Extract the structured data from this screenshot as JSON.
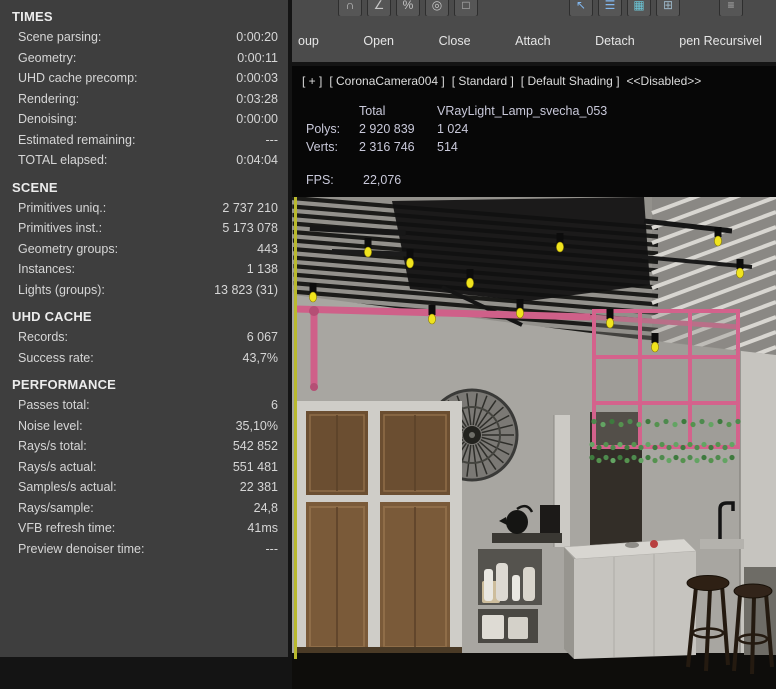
{
  "panel": {
    "sections": [
      {
        "title": "TIMES",
        "rows": [
          {
            "label": "Scene parsing:",
            "value": "0:00:20"
          },
          {
            "label": "Geometry:",
            "value": "0:00:11"
          },
          {
            "label": "UHD cache precomp:",
            "value": "0:00:03"
          },
          {
            "label": "Rendering:",
            "value": "0:03:28"
          },
          {
            "label": "Denoising:",
            "value": "0:00:00"
          },
          {
            "label": "Estimated remaining:",
            "value": "---"
          },
          {
            "label": "TOTAL elapsed:",
            "value": "0:04:04"
          }
        ]
      },
      {
        "title": "SCENE",
        "rows": [
          {
            "label": "Primitives uniq.:",
            "value": "2 737 210"
          },
          {
            "label": "Primitives inst.:",
            "value": "5 173 078"
          },
          {
            "label": "Geometry groups:",
            "value": "443"
          },
          {
            "label": "Instances:",
            "value": "1 138"
          },
          {
            "label": "Lights (groups):",
            "value": "13 823 (31)"
          }
        ]
      },
      {
        "title": "UHD CACHE",
        "rows": [
          {
            "label": "Records:",
            "value": "6 067"
          },
          {
            "label": "Success rate:",
            "value": "43,7%"
          }
        ]
      },
      {
        "title": "PERFORMANCE",
        "rows": [
          {
            "label": "Passes total:",
            "value": "6"
          },
          {
            "label": "Noise level:",
            "value": "35,10%"
          },
          {
            "label": "Rays/s total:",
            "value": "542 852"
          },
          {
            "label": "Rays/s actual:",
            "value": "551 481"
          },
          {
            "label": "Samples/s actual:",
            "value": "22 381"
          },
          {
            "label": "Rays/sample:",
            "value": "24,8"
          },
          {
            "label": "VFB refresh time:",
            "value": "41ms"
          },
          {
            "label": "Preview denoiser time:",
            "value": "---"
          }
        ]
      }
    ]
  },
  "toolbar": {
    "buttons": [
      {
        "name": "group-button",
        "label": "oup"
      },
      {
        "name": "open-button",
        "label": "Open"
      },
      {
        "name": "close-button",
        "label": "Close"
      },
      {
        "name": "attach-button",
        "label": "Attach"
      },
      {
        "name": "detach-button",
        "label": "Detach"
      },
      {
        "name": "open-recursively-button",
        "label": "pen Recursivel"
      }
    ],
    "icons": [
      {
        "name": "snap-toggle-icon",
        "glyph": "∩",
        "color": "#c6c6c6",
        "group": "a"
      },
      {
        "name": "angle-snap-toggle-icon",
        "glyph": "∠",
        "color": "#c6c6c6",
        "group": "a"
      },
      {
        "name": "percent-snap-toggle-icon",
        "glyph": "%",
        "color": "#c6c6c6",
        "group": "a"
      },
      {
        "name": "spinner-snap-toggle-icon",
        "glyph": "◎",
        "color": "#c6c6c6",
        "group": "a"
      },
      {
        "name": "named-selection-sets-icon",
        "glyph": "□",
        "color": "#c6c6c6",
        "group": "a"
      },
      {
        "name": "select-object-cursor-icon",
        "glyph": "↖",
        "color": "#82b8f0",
        "group": "b"
      },
      {
        "name": "select-by-name-icon",
        "glyph": "☰",
        "color": "#82b8f0",
        "group": "b"
      },
      {
        "name": "selection-region-icon",
        "glyph": "▦",
        "color": "#6cc4d4",
        "group": "b"
      },
      {
        "name": "window-crossing-selection-icon",
        "glyph": "⊞",
        "color": "#9ab4c4",
        "group": "b"
      },
      {
        "name": "manage-layers-icon",
        "glyph": "≡",
        "color": "#b0b0b0",
        "group": "c"
      }
    ]
  },
  "viewport": {
    "header": {
      "segments": [
        "[ + ]",
        "[ CoronaCamera004 ]",
        "[ Standard ]",
        "[ Default Shading ]",
        "<<Disabled>>"
      ]
    },
    "stats": {
      "col_total": "Total",
      "col_selected": "VRayLight_Lamp_svecha_053",
      "polys_label": "Polys:",
      "polys_total": "2 920 839",
      "polys_selected": "1 024",
      "verts_label": "Verts:",
      "verts_total": "2 316 746",
      "verts_selected": "514",
      "fps_label": "FPS:",
      "fps_value": "22,076"
    }
  },
  "colors": {
    "accent_yellow": "#f0e41e",
    "accent_pink": "#cf6089",
    "panel_bg": "#3e3e3e",
    "viewport_bg": "#070707"
  }
}
